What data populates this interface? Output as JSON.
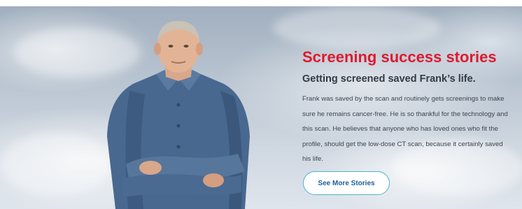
{
  "hero": {
    "heading": "Screening success stories",
    "subheading": "Getting screened saved Frank’s life.",
    "body": "Frank was saved by the scan and routinely gets screenings to make sure he remains cancer-free. He is so thankful for the technology and this scan. He believes that anyone who has loved ones who fit the profile, should get the low-dose CT scan, because it certainly saved his life.",
    "cta_label": "See More Stories"
  },
  "colors": {
    "heading": "#e0192e",
    "subheading": "#333a45",
    "button_border": "#4fb3c9",
    "button_text": "#1b5f9e"
  }
}
